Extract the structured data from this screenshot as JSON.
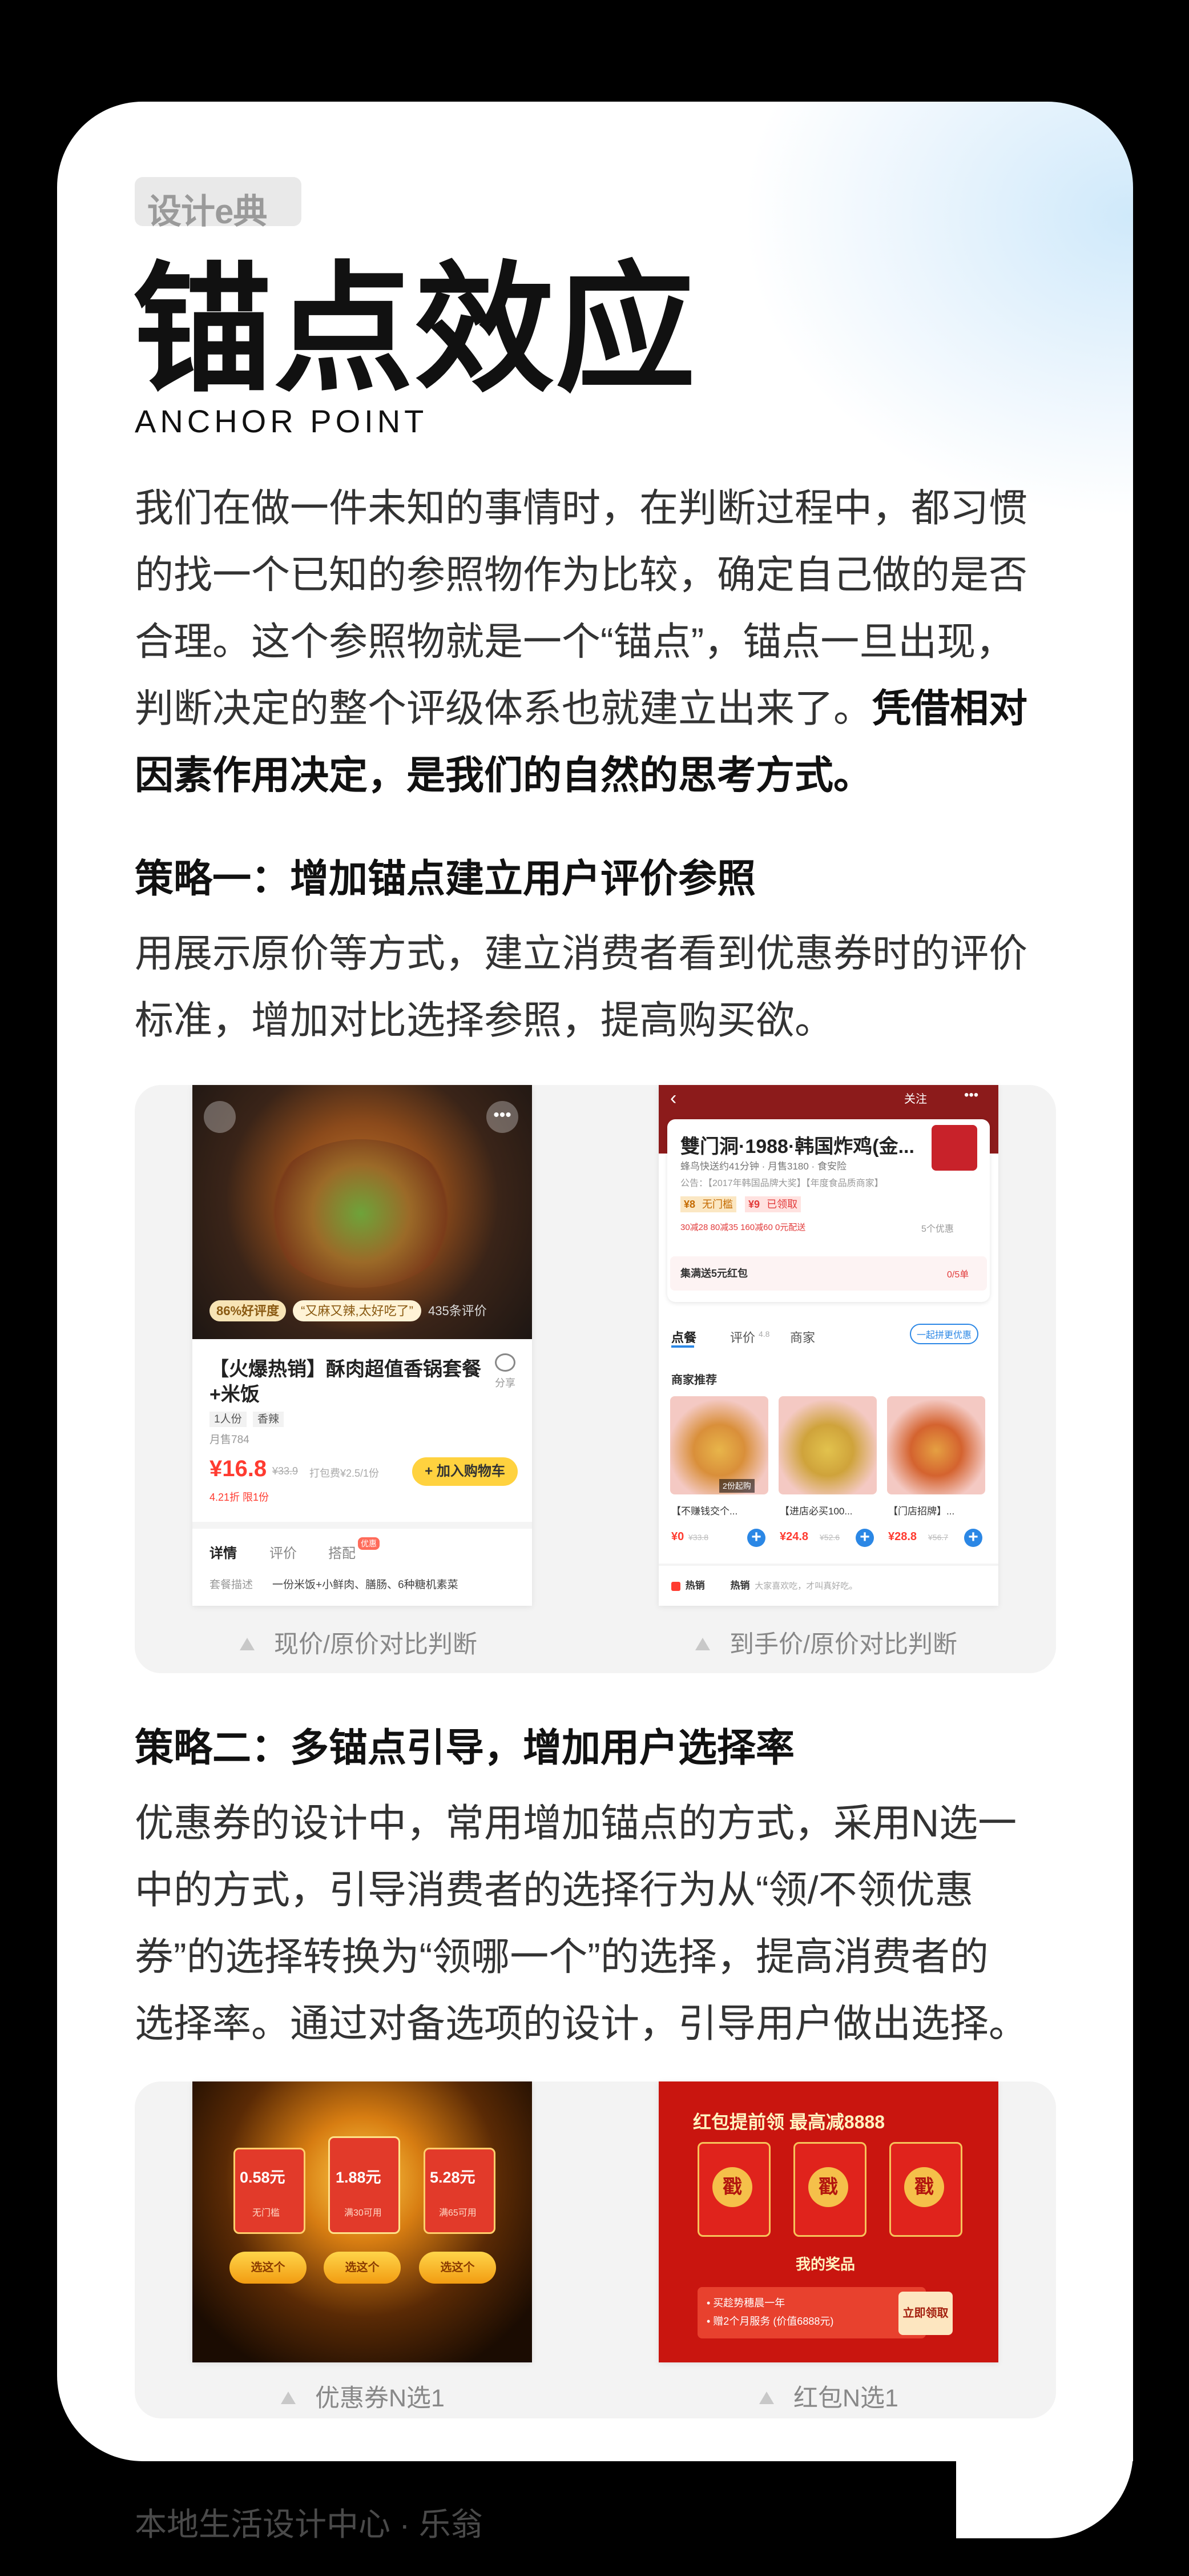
{
  "badge": "设计e典",
  "title": "锚点效应",
  "subtitle": "ANCHOR POINT",
  "intro": {
    "line1": "我们在做一件未知的事情时，在判断过程中，都习惯",
    "line2": "的找一个已知的参照物作为比较，确定自己做的是否",
    "line3": "合理。这个参照物就是一个“锚点”，锚点一旦出现，",
    "line4_normal": "判断决定的整个评级体系也就建立出来了。",
    "line4_bold": "凭借相对",
    "line5_bold": "因素作用决定，是我们的自然的思考方式。"
  },
  "strategy1": {
    "heading": "策略一：增加锚点建立用户评价参照",
    "line1": "用展示原价等方式，建立消费者看到优惠券时的评价",
    "line2": "标准，增加对比选择参照，提高购买欲。",
    "caption_left": "现价/原价对比判断",
    "caption_right": "到手价/原价对比判断"
  },
  "shot1": {
    "rating": "86%好评度",
    "quote": "“又麻又辣,太好吃了”",
    "reviews": "435条评价",
    "product_title_1": "【火爆热销】酥肉超值香锅套餐",
    "product_title_2": "+米饭",
    "share": "分享",
    "tag1": "1人份",
    "tag2": "香辣",
    "monthly": "月售784",
    "price": "¥16.8",
    "orig_price": "¥33.9",
    "discount_note": "打包费¥2.5/1份",
    "sub_note": "4.21折 限1份",
    "add_cart": "+ 加入购物车",
    "tab1": "详情",
    "tab2": "评价",
    "tab3": "搭配",
    "tab3_badge": "优惠",
    "desc_label": "套餐描述",
    "desc": "一份米饭+小鲜肉、膳肠、6种糖机素菜"
  },
  "shot2": {
    "follow": "关注",
    "store_name": "雙门洞·1988·韩国炸鸡(金...",
    "store_meta": "蜂鸟快送约41分钟 · 月售3180 · 食安险",
    "notice": "公告：【2017年韩国品牌大奖】【年度食品质商家】",
    "coupon1": "¥8",
    "coupon1_label": "无门槛",
    "coupon2": "¥9",
    "coupon2_label": "已领取",
    "promos": "30减28  80减35  160减60  0元配送",
    "more_promos": "5个优惠",
    "redpacket": "集满送5元红包",
    "progress": "0/5单",
    "tab_order": "点餐",
    "tab_review": "评价",
    "tab_review_score": "4.8",
    "tab_store": "商家",
    "group_btn": "一起拼更优惠",
    "recommend": "商家推荐",
    "item1_name": "【不赚钱交个...",
    "item1_price": "¥0",
    "item1_orig": "¥33.8",
    "item1_badge": "2份起购",
    "item2_name": "【进店必买100...",
    "item2_price": "¥24.8",
    "item2_orig": "¥52.6",
    "item3_name": "【门店招牌】...",
    "item3_price": "¥28.8",
    "item3_orig": "¥56.7",
    "hot_label": "热销",
    "hot_text": "大家喜欢吃，才叫真好吃。"
  },
  "strategy2": {
    "heading": "策略二：多锚点引导，增加用户选择率",
    "line1": "优惠券的设计中，常用增加锚点的方式，采用N选一",
    "line2": "中的方式，引导消费者的选择行为从“领/不领优惠",
    "line3": "券”的选择转换为“领哪一个”的选择，提高消费者的",
    "line4": "选择率。通过对备选项的设计，引导用户做出选择。",
    "caption_left": "优惠券N选1",
    "caption_right": "红包N选1"
  },
  "shot3": {
    "coupons": [
      {
        "amount": "0.58元",
        "cond": "无门槛",
        "btn": "选这个"
      },
      {
        "amount": "1.88元",
        "cond": "满30可用",
        "btn": "选这个"
      },
      {
        "amount": "5.28元",
        "cond": "满65可用",
        "btn": "选这个"
      }
    ]
  },
  "shot4": {
    "header": "红包提前领 最高减8888",
    "packet_char": "戳",
    "prize_title": "我的奖品",
    "prize_line1": "• 买趁势穗晨一年",
    "prize_line2": "• 赠2个月服务 (价值6888元)",
    "claim": "立即领取"
  },
  "footer": "本地生活设计中心 · 乐翁"
}
